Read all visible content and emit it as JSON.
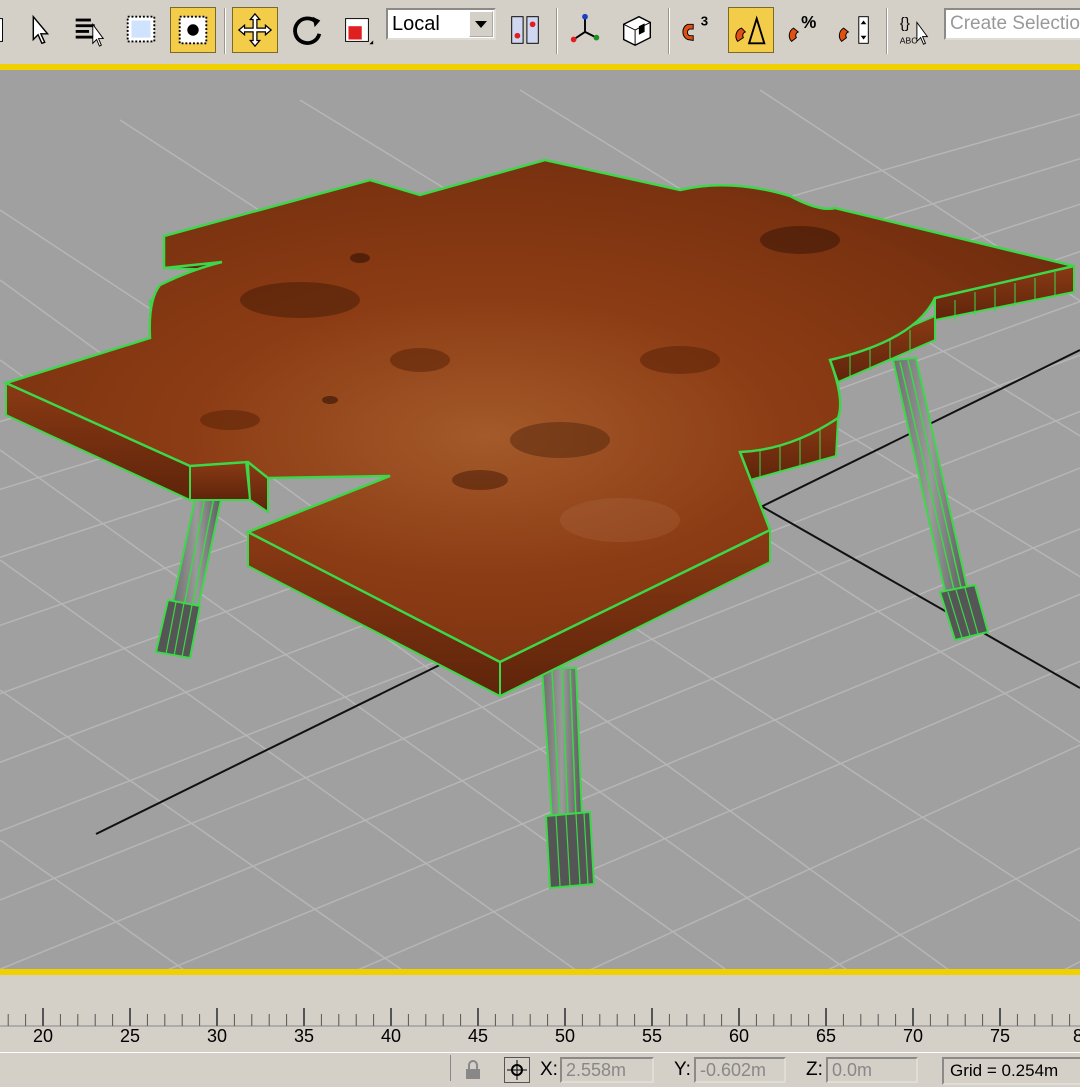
{
  "toolbar": {
    "coord_system": "Local",
    "selection_set_placeholder": "Create Selection Set",
    "snap_angle_label": "3",
    "percent_snap_label": "%",
    "spinner_snap_label": "ABC"
  },
  "timeline": {
    "ticks": [
      "20",
      "25",
      "30",
      "35",
      "40",
      "45",
      "50",
      "55",
      "60",
      "65",
      "70",
      "75",
      "8"
    ]
  },
  "status": {
    "x_label": "X:",
    "x_value": "2.558m",
    "y_label": "Y:",
    "y_value": "-0.602m",
    "z_label": "Z:",
    "z_value": "0.0m",
    "grid": "Grid = 0.254m"
  },
  "scene": {
    "object": "coffee table with burl-wood top and four legs",
    "selection_color": "#3cd84a",
    "viewport_background": "#a0a0a0",
    "grid_color": "#b4b4b4",
    "wood_color": "#8a3a12"
  }
}
